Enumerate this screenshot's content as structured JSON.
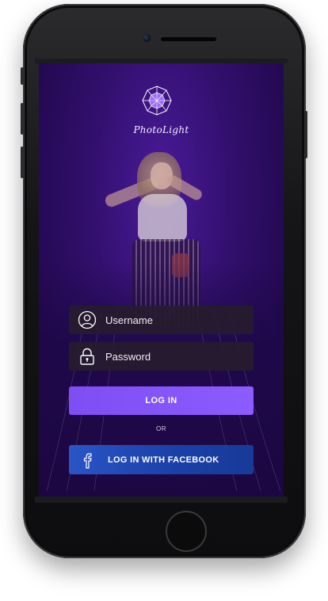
{
  "app": {
    "title": "PhotoLight",
    "logo_icon": "geodesic-ball-logo-icon"
  },
  "login_form": {
    "username": {
      "placeholder": "Username",
      "value": "",
      "icon": "user-icon"
    },
    "password": {
      "placeholder": "Password",
      "value": "",
      "icon": "lock-icon"
    },
    "login_button_label": "LOG IN",
    "separator_text": "OR",
    "facebook_button_label": "LOG IN WITH FACEBOOK",
    "facebook_icon": "facebook-icon"
  },
  "colors": {
    "background_purple": "#32106e",
    "login_button": "#8455f8",
    "facebook_button": "#2149b8",
    "field_background": "#261c2c"
  }
}
